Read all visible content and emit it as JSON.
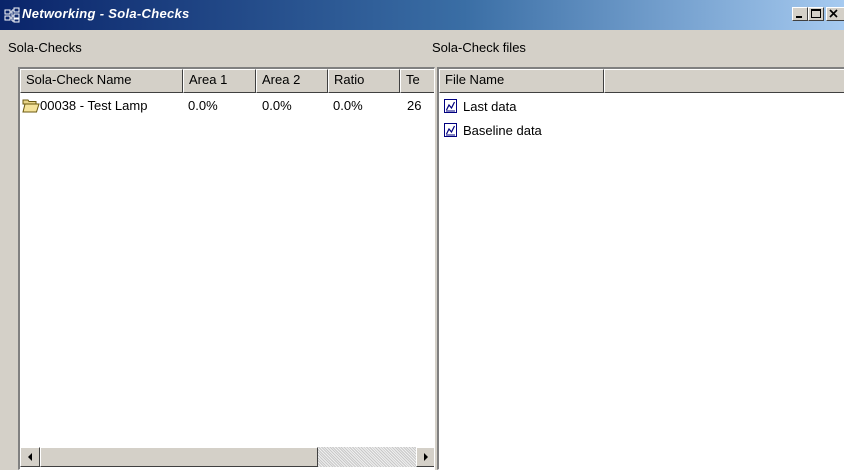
{
  "window": {
    "title": "Networking - Sola-Checks"
  },
  "left_pane": {
    "label": "Sola-Checks",
    "columns": [
      "Sola-Check Name",
      "Area 1",
      "Area 2",
      "Ratio",
      "Te"
    ],
    "rows": [
      {
        "name": "00038 - Test Lamp",
        "area1": "0.0%",
        "area2": "0.0%",
        "ratio": "0.0%",
        "te": "26",
        "icon": "folder-open-icon"
      }
    ]
  },
  "right_pane": {
    "label": "Sola-Check files",
    "columns": [
      "File Name",
      ""
    ],
    "files": [
      {
        "name": "Last data",
        "icon": "data-file-icon"
      },
      {
        "name": "Baseline data",
        "icon": "data-file-icon"
      }
    ]
  },
  "colors": {
    "titlebar_start": "#0a246a",
    "titlebar_end": "#a6caf0",
    "face": "#d4d0c8"
  }
}
